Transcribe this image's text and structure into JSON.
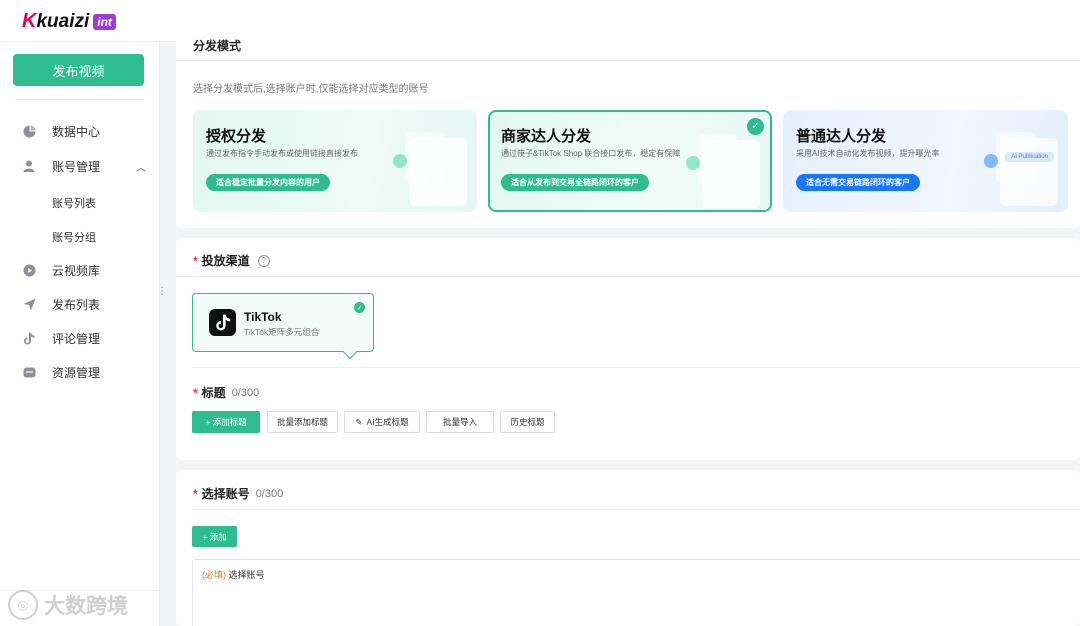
{
  "brand": {
    "logo_k": "K",
    "logo_text": "kuaizi",
    "logo_tag": "int"
  },
  "sidebar": {
    "publish_label": "发布视频",
    "items": [
      {
        "label": "数据中心",
        "icon": "pie-chart-icon"
      },
      {
        "label": "账号管理",
        "icon": "user-icon"
      },
      {
        "label": "云视频库",
        "icon": "play-circle-icon"
      },
      {
        "label": "发布列表",
        "icon": "send-icon"
      },
      {
        "label": "评论管理",
        "icon": "tiktok-note-icon"
      },
      {
        "label": "资源管理",
        "icon": "box-icon"
      }
    ],
    "sub_items": [
      "账号列表",
      "账号分组"
    ]
  },
  "mode_section": {
    "title": "分发模式",
    "desc": "选择分发模式后,选择账户时,仅能选择对应类型的账号",
    "modes": [
      {
        "title": "授权分发",
        "sub": "通过发布指令手动发布或使用链接直接发布",
        "pill": "适合稳定批量分发内容的用户"
      },
      {
        "title": "商家达人分发",
        "sub": "通过筷子&TikTok Shop 联合接口发布，稳定有保障",
        "pill": "适合从发布到交易全链路闭环的客户"
      },
      {
        "title": "普通达人分发",
        "sub": "采用AI技术自动化发布视频，提升曝光率",
        "pill": "适合无需交易链路闭环的客户",
        "tag": "AI Publication"
      }
    ]
  },
  "channel_section": {
    "title": "投放渠道",
    "channel": {
      "name": "TikTok",
      "sub": "TikTok矩阵多元组合"
    }
  },
  "title_section": {
    "title": "标题",
    "count": "0/300",
    "buttons": [
      "+ 添加标题",
      "批量添加标题",
      "AI生成标题",
      "批量导入",
      "历史标题"
    ]
  },
  "account_section": {
    "title": "选择账号",
    "count": "0/300",
    "add_label": "+ 添加",
    "placeholder_req": "(必填)",
    "placeholder_text": " 选择账号"
  },
  "watermark": "大数跨境",
  "colors": {
    "accent": "#2ebd8f",
    "blue": "#1677ff",
    "required": "#e53935"
  }
}
